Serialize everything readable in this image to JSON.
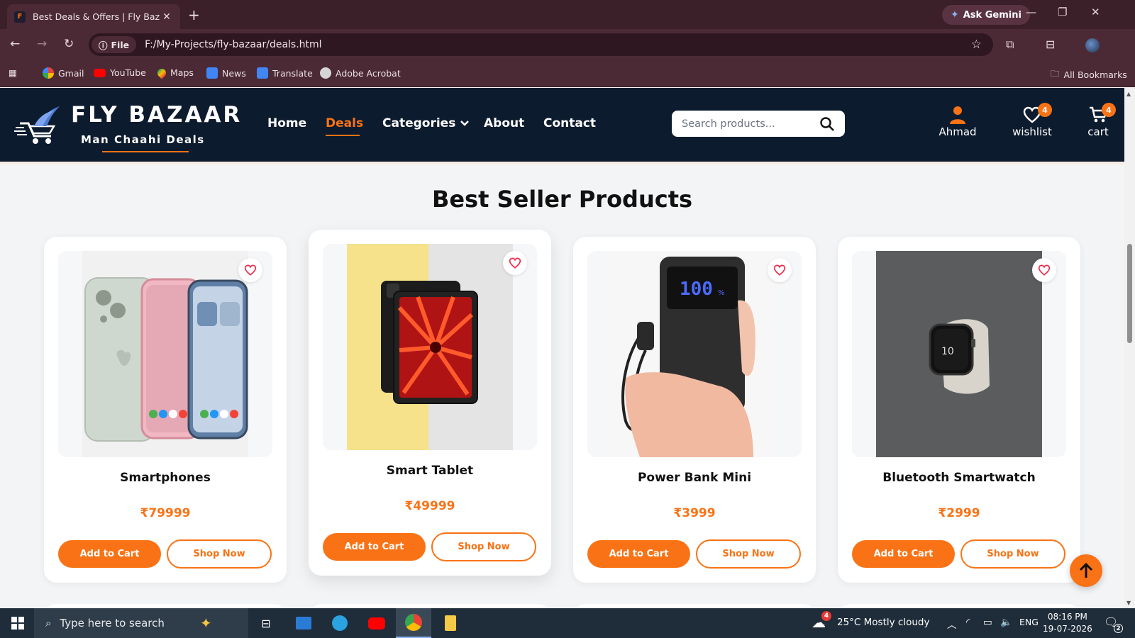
{
  "browser": {
    "tab_title": "Best Deals & Offers | Fly Bazaar",
    "favicon_letter": "F",
    "ask_gemini": "Ask Gemini",
    "file_chip": "File",
    "url": "F:/My-Projects/fly-bazaar/deals.html",
    "bookmarks": [
      "Gmail",
      "YouTube",
      "Maps",
      "News",
      "Translate",
      "Adobe Acrobat"
    ],
    "all_bookmarks": "All Bookmarks"
  },
  "site": {
    "brand": "FLY BAZAAR",
    "tagline": "Man Chaahi Deals",
    "nav": [
      "Home",
      "Deals",
      "Categories",
      "About",
      "Contact"
    ],
    "active_nav": "Deals",
    "search_placeholder": "Search products...",
    "user_name": "Ahmad",
    "wishlist_label": "wishlist",
    "wishlist_count": "4",
    "cart_label": "cart",
    "cart_count": "4",
    "accent_color": "#f97316",
    "header_color": "#0d1b2e"
  },
  "main": {
    "section_title": "Best Seller Products",
    "products": [
      {
        "name": "Smartphones",
        "price": "₹79999",
        "add_label": "Add to Cart",
        "shop_label": "Shop Now",
        "image": "smartphone-image"
      },
      {
        "name": "Smart Tablet",
        "price": "₹49999",
        "add_label": "Add to Cart",
        "shop_label": "Shop Now",
        "image": "tablet-image"
      },
      {
        "name": "Power Bank Mini",
        "price": "₹3999",
        "add_label": "Add to Cart",
        "shop_label": "Shop Now",
        "image": "powerbank-image"
      },
      {
        "name": "Bluetooth Smartwatch",
        "price": "₹2999",
        "add_label": "Add to Cart",
        "shop_label": "Shop Now",
        "image": "smartwatch-image"
      }
    ]
  },
  "taskbar": {
    "search_placeholder": "Type here to search",
    "weather": "25°C  Mostly cloudy",
    "weather_badge": "4",
    "language": "ENG",
    "time": "08:16 PM",
    "date": "19-07-2026",
    "notification_count": "2"
  }
}
